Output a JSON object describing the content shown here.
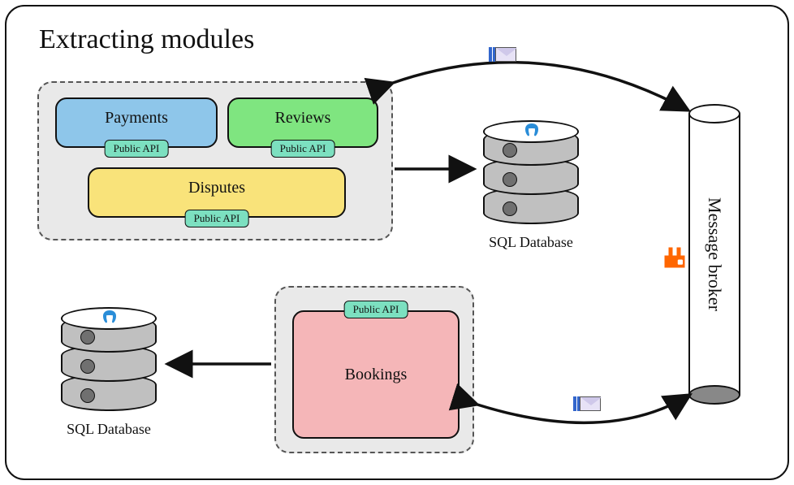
{
  "title": "Extracting modules",
  "modules": {
    "payments": {
      "label": "Payments",
      "api": "Public API"
    },
    "reviews": {
      "label": "Reviews",
      "api": "Public API"
    },
    "disputes": {
      "label": "Disputes",
      "api": "Public API"
    },
    "bookings": {
      "label": "Bookings",
      "api": "Public API"
    }
  },
  "db": {
    "top": {
      "label": "SQL Database",
      "engine_icon": "postgresql-icon"
    },
    "bottom": {
      "label": "SQL Database",
      "engine_icon": "postgresql-icon"
    }
  },
  "broker": {
    "label": "Message broker",
    "icon": "rabbitmq-icon"
  },
  "icons": {
    "envelope": "envelope-icon"
  },
  "colors": {
    "payments": "#8ec6ea",
    "reviews": "#7fe580",
    "disputes": "#f9e37a",
    "bookings": "#f5b6b8",
    "api_badge": "#7ce0c0",
    "rabbitmq": "#ff6600",
    "postgres": "#2a8dd8"
  }
}
